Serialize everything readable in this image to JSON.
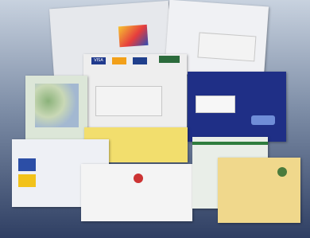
{
  "envelopes": {
    "top_left": {
      "text": "",
      "color": "#e6e8ec"
    },
    "top_right": {
      "text": "",
      "color": "#f0f1f4"
    },
    "cards": {
      "labels": [
        "VISA",
        "",
        "",
        ""
      ],
      "color": "#eeeeee"
    },
    "map": {
      "color": "#dce6d8"
    },
    "blue": {
      "color": "#1f2f86"
    },
    "yellow": {
      "text": "",
      "color": "#f2de6d"
    },
    "small_left": {
      "color": "#eef0f5"
    },
    "bottom_center": {
      "text": "",
      "color": "#f4f4f4"
    },
    "green_stripe": {
      "color": "#e9eee8"
    },
    "kraft": {
      "color": "#f0d88c"
    }
  },
  "icons": {
    "logo": "logo-icon",
    "sticker": "sticker-icon",
    "seal": "seal-icon"
  }
}
